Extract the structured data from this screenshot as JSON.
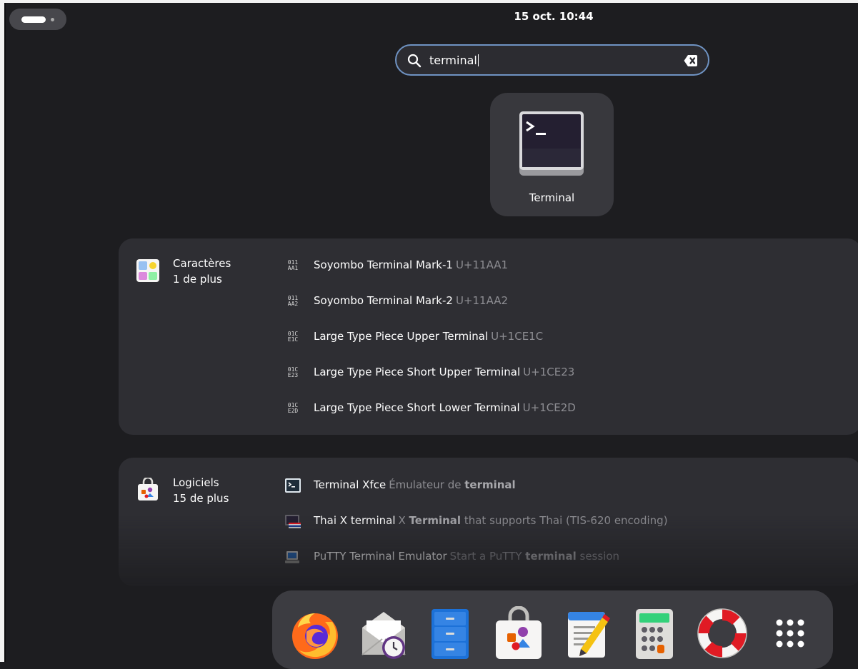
{
  "clock": "15 oct.  10:44",
  "search": {
    "query": "terminal"
  },
  "top_result": {
    "label": "Terminal"
  },
  "providers": [
    {
      "name": "Caractères",
      "more": "1 de plus",
      "results": [
        {
          "glyph": [
            "011",
            "AA1"
          ],
          "title": "Soyombo Terminal Mark-1",
          "subtitle": "U+11AA1"
        },
        {
          "glyph": [
            "011",
            "AA2"
          ],
          "title": "Soyombo Terminal Mark-2",
          "subtitle": "U+11AA2"
        },
        {
          "glyph": [
            "01C",
            "E1C"
          ],
          "title": "Large Type Piece Upper Terminal",
          "subtitle": "U+1CE1C"
        },
        {
          "glyph": [
            "01C",
            "E23"
          ],
          "title": "Large Type Piece Short Upper Terminal",
          "subtitle": "U+1CE23"
        },
        {
          "glyph": [
            "01C",
            "E2D"
          ],
          "title": "Large Type Piece Short Lower Terminal",
          "subtitle": "U+1CE2D"
        }
      ]
    },
    {
      "name": "Logiciels",
      "more": "15 de plus",
      "results": [
        {
          "title": "Terminal Xfce",
          "subtitle_pre": "Émulateur de ",
          "subtitle_bold": "terminal",
          "subtitle_post": ""
        },
        {
          "title": "Thai X terminal",
          "subtitle_pre": "X ",
          "subtitle_bold": "Terminal",
          "subtitle_post": " that supports Thai (TIS-620 encoding)"
        },
        {
          "title": "PuTTY Terminal Emulator",
          "subtitle_pre": "Start a PuTTY ",
          "subtitle_bold": "terminal",
          "subtitle_post": " session"
        }
      ]
    }
  ],
  "dock": [
    "firefox-icon",
    "evolution-mail-icon",
    "files-icon",
    "software-icon",
    "text-editor-icon",
    "calculator-icon",
    "help-icon",
    "app-grid-icon"
  ]
}
